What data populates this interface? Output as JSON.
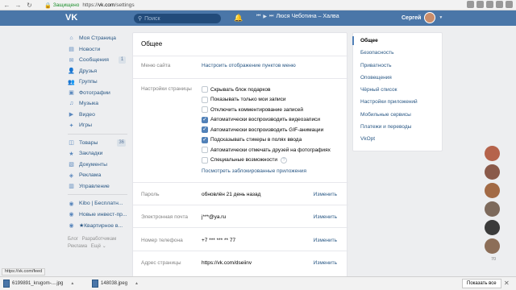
{
  "browser": {
    "secure_label": "Защищено",
    "url_scheme": "https://",
    "url_host": "vk.com",
    "url_path": "/settings"
  },
  "header": {
    "search_placeholder": "Поиск",
    "player_text": "Люся Чеботина – Халва",
    "user_name": "Сергей"
  },
  "left_menu": {
    "items": [
      {
        "label": "Моя Страница",
        "icon": "home-icon",
        "glyph": "⌂"
      },
      {
        "label": "Новости",
        "icon": "news-icon",
        "glyph": "▤"
      },
      {
        "label": "Сообщения",
        "icon": "messages-icon",
        "glyph": "✉",
        "badge": "1"
      },
      {
        "label": "Друзья",
        "icon": "friends-icon",
        "glyph": "👤"
      },
      {
        "label": "Группы",
        "icon": "groups-icon",
        "glyph": "👥"
      },
      {
        "label": "Фотографии",
        "icon": "photos-icon",
        "glyph": "▣"
      },
      {
        "label": "Музыка",
        "icon": "music-icon",
        "glyph": "♫"
      },
      {
        "label": "Видео",
        "icon": "video-icon",
        "glyph": "▶"
      },
      {
        "label": "Игры",
        "icon": "games-icon",
        "glyph": "✦"
      }
    ],
    "items2": [
      {
        "label": "Товары",
        "icon": "goods-icon",
        "glyph": "◫",
        "badge": "36"
      },
      {
        "label": "Закладки",
        "icon": "bookmarks-icon",
        "glyph": "★"
      },
      {
        "label": "Документы",
        "icon": "documents-icon",
        "glyph": "▧"
      },
      {
        "label": "Реклама",
        "icon": "ads-icon",
        "glyph": "◈"
      },
      {
        "label": "Управление",
        "icon": "manage-icon",
        "glyph": "▥"
      }
    ],
    "items3": [
      {
        "label": "Kibo | Бесплатн...",
        "icon": "app-icon",
        "glyph": "◉"
      },
      {
        "label": "Новые инвест-пр...",
        "icon": "app-icon",
        "glyph": "◉"
      },
      {
        "label": "★Квартирное в...",
        "icon": "app-icon",
        "glyph": "◉"
      }
    ],
    "footer": [
      "Блог",
      "Разработчикам",
      "Реклама",
      "Ещё ⌄"
    ]
  },
  "main": {
    "title": "Общее",
    "menu_label": "Меню сайта",
    "menu_link": "Настроить отображение пунктов меню",
    "page_settings_label": "Настройки страницы",
    "checkboxes": [
      {
        "label": "Скрывать блок подарков",
        "checked": false
      },
      {
        "label": "Показывать только мои записи",
        "checked": false
      },
      {
        "label": "Отключить комментирование записей",
        "checked": false
      },
      {
        "label": "Автоматически воспроизводить видеозаписи",
        "checked": true
      },
      {
        "label": "Автоматически воспроизводить GIF-анимации",
        "checked": true
      },
      {
        "label": "Подсказывать стикеры в полях ввода",
        "checked": true
      },
      {
        "label": "Автоматически отмечать друзей на фотографиях",
        "checked": false
      },
      {
        "label": "Специальные возможности",
        "checked": false,
        "help": "?"
      }
    ],
    "blocked_apps_link": "Посмотреть заблокированные приложения",
    "password_label": "Пароль",
    "password_value": "обновлён 21 день назад",
    "email_label": "Электронная почта",
    "email_value": "j***@ya.ru",
    "phone_label": "Номер телефона",
    "phone_value": "+7 *** *** ** 77",
    "address_label": "Адрес страницы",
    "address_value": "https://vk.com/dseiinv",
    "change_label": "Изменить"
  },
  "right_menu": {
    "items": [
      "Общее",
      "Безопасность",
      "Приватность",
      "Оповещения",
      "Чёрный список",
      "Настройки приложений",
      "Мобильные сервисы",
      "Платежи и переводы",
      "VkOpt"
    ]
  },
  "friends_online": {
    "count": "70",
    "colors": [
      "#b5634b",
      "#8a5a4a",
      "#a26a45",
      "#7d6a5c",
      "#3b3b3b",
      "#8c6e58"
    ]
  },
  "status": {
    "hover_url": "https://vk.com/feed",
    "downloads": [
      "6199891_krugom-....jpg",
      "148038.jpeg"
    ],
    "show_all": "Показать все"
  }
}
